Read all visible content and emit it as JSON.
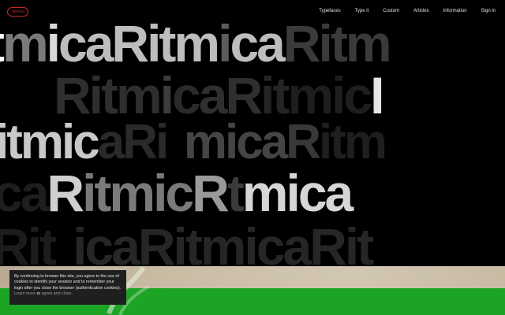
{
  "brand": {
    "logo_text": "ritmica"
  },
  "nav": [
    {
      "label": "Typefaces"
    },
    {
      "label": "Type it"
    },
    {
      "label": "Custom"
    },
    {
      "label": "Articles"
    },
    {
      "label": "Information"
    },
    {
      "label": "Sign in"
    }
  ],
  "hero_rows": [
    {
      "segments": [
        {
          "text": "t",
          "color": "#ffffff"
        },
        {
          "text": "m",
          "color": "#7a7a7a"
        },
        {
          "text": "i",
          "color": "#d9d9d9"
        },
        {
          "text": "caRitm",
          "color": "#bdbdbd"
        },
        {
          "text": "i",
          "color": "#5c5c5c"
        },
        {
          "text": "ca",
          "color": "#bdbdbd"
        },
        {
          "text": "Ritm",
          "color": "#3a3a3a"
        }
      ]
    },
    {
      "segments": [
        {
          "text": "Ritm",
          "color": "#2e2e2e"
        },
        {
          "text": "i",
          "color": "#3b3b3b"
        },
        {
          "text": "c",
          "color": "#2a2a2a"
        },
        {
          "text": "aR",
          "color": "#2f2f2f"
        },
        {
          "text": "it",
          "color": "#242424"
        },
        {
          "text": "mic",
          "color": "#1e1e1e"
        },
        {
          "text": "I",
          "color": "#e5e5e5"
        }
      ]
    },
    {
      "segments": [
        {
          "text": "itmic",
          "color": "#c9c9c9"
        },
        {
          "text": "aRi",
          "color": "#2a2a2a"
        },
        {
          "text": " ",
          "color": "#000000"
        },
        {
          "text": "mica",
          "color": "#454545"
        },
        {
          "text": "R",
          "color": "#383838"
        },
        {
          "text": "itm",
          "color": "#1f1f1f"
        }
      ]
    },
    {
      "segments": [
        {
          "text": "ca",
          "color": "#1e1e1e"
        },
        {
          "text": "R",
          "color": "#cfcfcf"
        },
        {
          "text": "itmic",
          "color": "#7a7a7a"
        },
        {
          "text": " R",
          "color": "#9a9a9a"
        },
        {
          "text": " t",
          "color": "#3a3a3a"
        },
        {
          "text": "mica",
          "color": "#d6d6d6"
        }
      ]
    },
    {
      "segments": [
        {
          "text": "Rit",
          "color": "#1c1c1c"
        },
        {
          "text": " ",
          "color": "#000000"
        },
        {
          "text": "icaRitmicaRit",
          "color": "#262626"
        }
      ]
    }
  ],
  "cookie": {
    "text": "By continuing to browse this site, you agree to the use of cookies to identify your session and to remember your login after you close the browser (authentication cookies).",
    "learn_more": "Learn more",
    "or": " or ",
    "agree": "agree and close."
  }
}
